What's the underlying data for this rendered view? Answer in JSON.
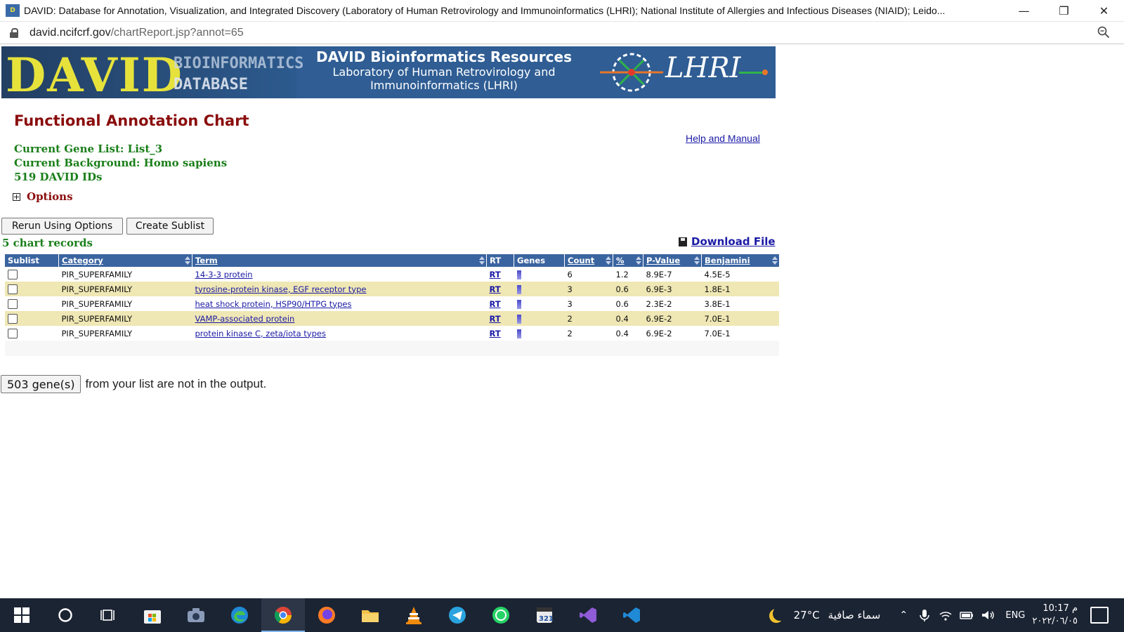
{
  "window": {
    "title": "DAVID: Database for Annotation, Visualization, and Integrated Discovery (Laboratory of Human Retrovirology and Immunoinformatics (LHRI); National Institute of Allergies and Infectious Diseases (NIAID); Leido...",
    "minimize": "—",
    "restore": "❐",
    "close": "✕"
  },
  "address": {
    "host": "david.ncifcrf.gov",
    "path": "/chartReport.jsp?annot=65"
  },
  "banner": {
    "logo_text": "DAVID",
    "logo_sub1": "BIOINFORMATICS",
    "logo_sub2": "DATABASE",
    "title": "DAVID Bioinformatics Resources",
    "subtitle": "Laboratory of Human Retrovirology and Immunoinformatics (LHRI)",
    "lhri_logo": "LHRI"
  },
  "page": {
    "heading": "Functional Annotation Chart",
    "help_link": "Help and Manual",
    "gene_list": "Current Gene List: List_3",
    "background": "Current Background: Homo sapiens",
    "ids": "519 DAVID IDs",
    "options": "Options",
    "rerun_button": "Rerun Using Options",
    "sublist_button": "Create Sublist",
    "records": "5 chart records",
    "download": "Download File",
    "not_output_button": "503 gene(s)",
    "not_output_text": "from your list are not in the output."
  },
  "table": {
    "headers": {
      "sublist": "Sublist",
      "category": "Category",
      "term": "Term",
      "rt": "RT",
      "genes": "Genes",
      "count": "Count",
      "percent": "%",
      "pvalue": "P-Value",
      "benjamini": "Benjamini"
    },
    "rows": [
      {
        "category": "PIR_SUPERFAMILY",
        "term": "14-3-3 protein",
        "rt": "RT",
        "count": "6",
        "percent": "1.2",
        "pvalue": "8.9E-7",
        "benjamini": "4.5E-5"
      },
      {
        "category": "PIR_SUPERFAMILY",
        "term": "tyrosine-protein kinase, EGF receptor type",
        "rt": "RT",
        "count": "3",
        "percent": "0.6",
        "pvalue": "6.9E-3",
        "benjamini": "1.8E-1"
      },
      {
        "category": "PIR_SUPERFAMILY",
        "term": "heat shock protein, HSP90/HTPG types",
        "rt": "RT",
        "count": "3",
        "percent": "0.6",
        "pvalue": "2.3E-2",
        "benjamini": "3.8E-1"
      },
      {
        "category": "PIR_SUPERFAMILY",
        "term": "VAMP-associated protein",
        "rt": "RT",
        "count": "2",
        "percent": "0.4",
        "pvalue": "6.9E-2",
        "benjamini": "7.0E-1"
      },
      {
        "category": "PIR_SUPERFAMILY",
        "term": "protein kinase C, zeta/iota types",
        "rt": "RT",
        "count": "2",
        "percent": "0.4",
        "pvalue": "6.9E-2",
        "benjamini": "7.0E-1"
      }
    ]
  },
  "taskbar": {
    "apps": [
      "windows-start",
      "cortana-search",
      "task-view",
      "microsoft-store",
      "camera",
      "edge",
      "chrome",
      "firefox",
      "file-explorer",
      "vlc",
      "telegram",
      "whatsapp",
      "media-player",
      "visual-studio",
      "vs-code"
    ],
    "weather_temp": "27°C",
    "weather_text": "سماء صافية",
    "lang": "ENG",
    "time": "10:17 م",
    "date": "٢٠٢٢/٠٦/٠٥"
  },
  "colors": {
    "banner_bg": "#2f5d94",
    "header_bg": "#3a64a0",
    "heading_red": "#8b0d0d",
    "meta_green": "#1a7f1a",
    "alt_row": "#efe7b4",
    "link_blue": "#1a1aa6",
    "taskbar_bg": "#1b2433"
  }
}
